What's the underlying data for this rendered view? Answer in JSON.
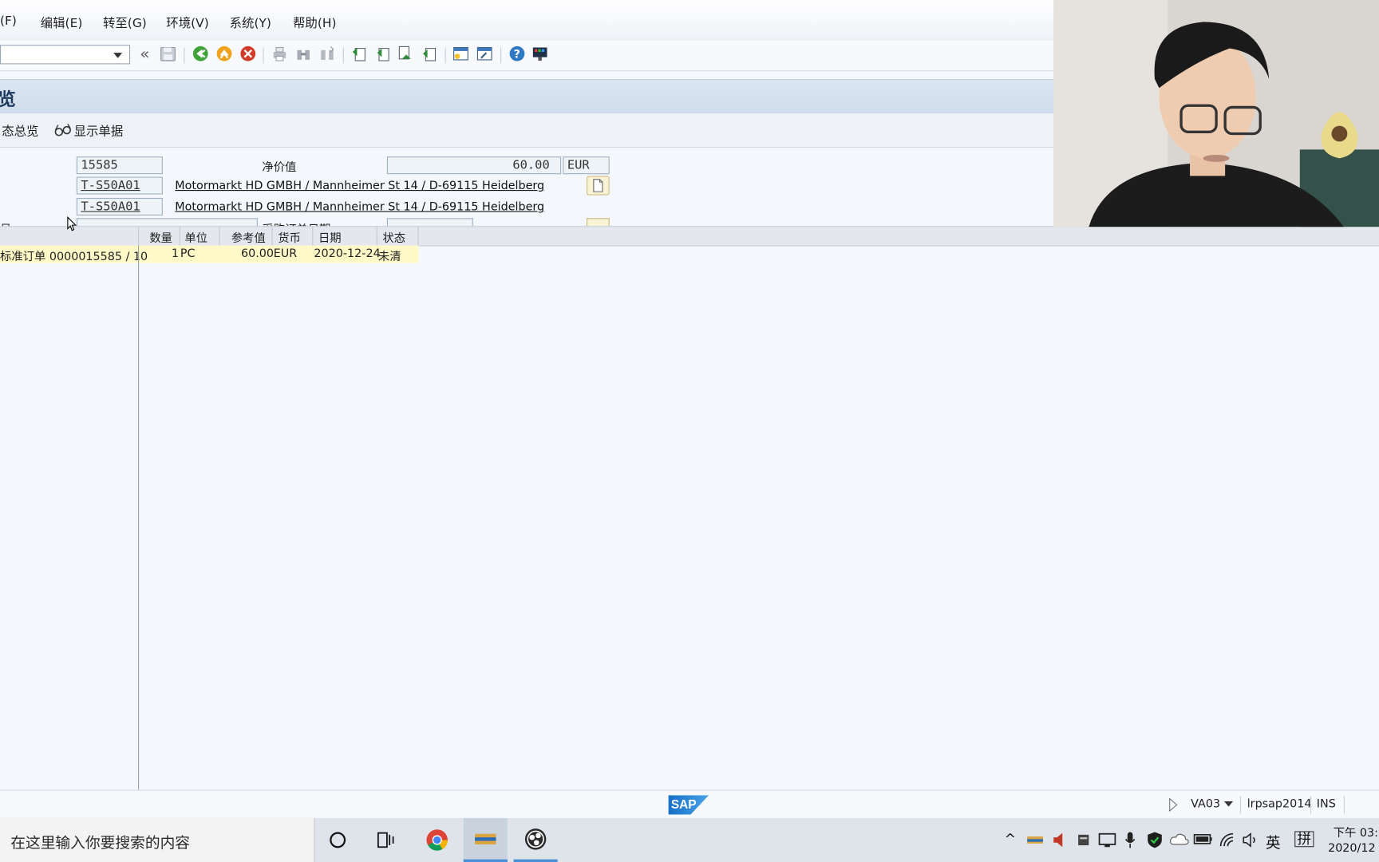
{
  "menu": [
    "(F)",
    "编辑(E)",
    "转至(G)",
    "环境(V)",
    "系统(Y)",
    "帮助(H)"
  ],
  "toolbar": {
    "command_value": "",
    "icons": [
      "back-arrows-icon",
      "save-icon",
      "back-icon",
      "exit-icon",
      "cancel-icon",
      "print-icon",
      "find-icon",
      "find-next-icon",
      "first-page-icon",
      "prev-page-icon",
      "next-page-icon",
      "last-page-icon",
      "new-session-icon",
      "shortcut-icon",
      "help-icon",
      "customize-layout-icon"
    ]
  },
  "title": "览",
  "app_toolbar": {
    "status_overview": "态总览",
    "display_document": "显示单据"
  },
  "header": {
    "doc_number": "15585",
    "net_value_label": "净价值",
    "net_value": "60.00",
    "currency": "EUR",
    "sold_to": "T-S50A01",
    "sold_to_address": "Motormarkt HD GMBH / Mannheimer St 14 / D-69115 Heidelberg",
    "ship_to": "T-S50A01",
    "ship_to_address": "Motormarkt HD GMBH / Mannheimer St 14 / D-69115 Heidelberg",
    "partial_left_label": "号",
    "partial_right_label": "采购订单日期"
  },
  "table": {
    "columns": [
      "数量",
      "单位",
      "参考值",
      "货币",
      "日期",
      "状态"
    ],
    "rows": [
      {
        "document": "标准订单 0000015585 / 10",
        "qty": "1",
        "unit": "PC",
        "ref_value": "60.00",
        "currency": "EUR",
        "date": "2020-12-24",
        "status": "未清"
      }
    ]
  },
  "status_bar": {
    "logo": "SAP",
    "transaction": "VA03",
    "server": "lrpsap2014",
    "mode": "INS"
  },
  "taskbar": {
    "search_placeholder": "在这里输入你要搜索的内容",
    "ime": "英",
    "ime2": "拼",
    "time": "下午 03:",
    "date": "2020/12"
  },
  "colors": {
    "selected_row": "#fff9c8",
    "title_text": "#1d3a5f",
    "sap_blue": "#1670c8"
  }
}
